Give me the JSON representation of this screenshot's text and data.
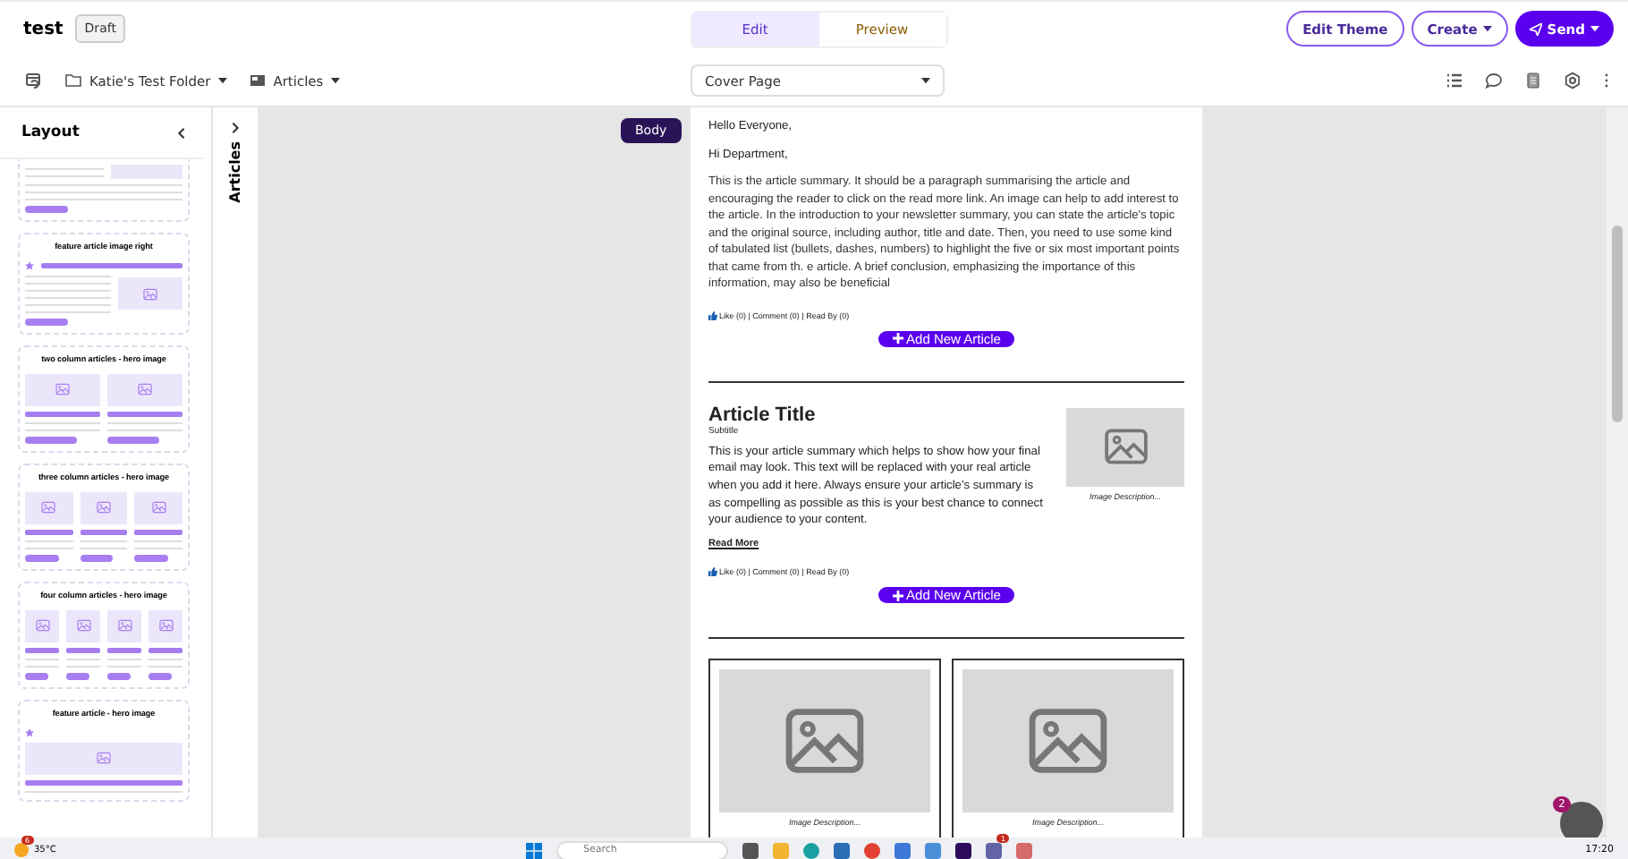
{
  "header": {
    "title": "test",
    "status": "Draft",
    "tabs": [
      {
        "label": "Edit",
        "selected": true
      },
      {
        "label": "Preview",
        "selected": false
      }
    ],
    "buttons": [
      {
        "label": "Edit Theme",
        "kind": "outline"
      },
      {
        "label": "Create",
        "kind": "outline-dropdown"
      },
      {
        "label": "Send",
        "kind": "primary-dropdown"
      }
    ]
  },
  "toolbar": {
    "folder": "Katie's Test Folder",
    "type": "Articles",
    "page_select": "Cover Page"
  },
  "layout_panel": {
    "title": "Layout",
    "cards": [
      {
        "kind": "cropped"
      },
      {
        "title": "feature article image right",
        "kind": "feature-right"
      },
      {
        "title": "two column articles - hero image",
        "kind": "two-column"
      },
      {
        "title": "three column articles - hero image",
        "kind": "three-column"
      },
      {
        "title": "four column articles - hero image",
        "kind": "four-column"
      },
      {
        "title": "feature article - hero image",
        "kind": "feature-hero"
      }
    ]
  },
  "side_tab": {
    "label": "Articles"
  },
  "email": {
    "section_tag": "Body",
    "greeting": "Hello Everyone,",
    "salutation": "Hi Department,",
    "summary": "This is the article summary. It should be a paragraph summarising the article and encouraging the reader to click on the read more link. An image can help to add interest to the article. In the introduction to your newsletter summary, you can state the article's topic and the original source, including author, title and date. Then, you need to use some kind of tabulated list (bullets, dashes, numbers) to highlight the five or six most important points that came from th. e article. A brief conclusion, emphasizing the importance of this information, may also be beneficial",
    "reactions": "Like (0) | Comment (0) | Read By (0)",
    "add_button": "Add New Article",
    "articles": [
      {
        "title": "Article Title",
        "subtitle": "Subtitle",
        "summary": "This is your article summary which helps to show how your final email may look. This text will be replaced with your real article when you add it here. Always ensure your article's summary is as compelling as possible as this is your best chance to connect your audience to your content.",
        "read_more": "Read More",
        "image_caption": "Image Description...",
        "reactions": "Like (0) | Comment (0) | Read By (0)",
        "add_button": "Add New Article"
      }
    ],
    "columns": [
      {
        "image_caption": "Image Description..."
      },
      {
        "image_caption": "Image Description..."
      }
    ]
  },
  "help": {
    "badge": "2"
  },
  "taskbar": {
    "weather_badge": "6",
    "temperature": "35°C",
    "search_placeholder": "Search",
    "teams_badge": "1",
    "time": "17:20"
  }
}
